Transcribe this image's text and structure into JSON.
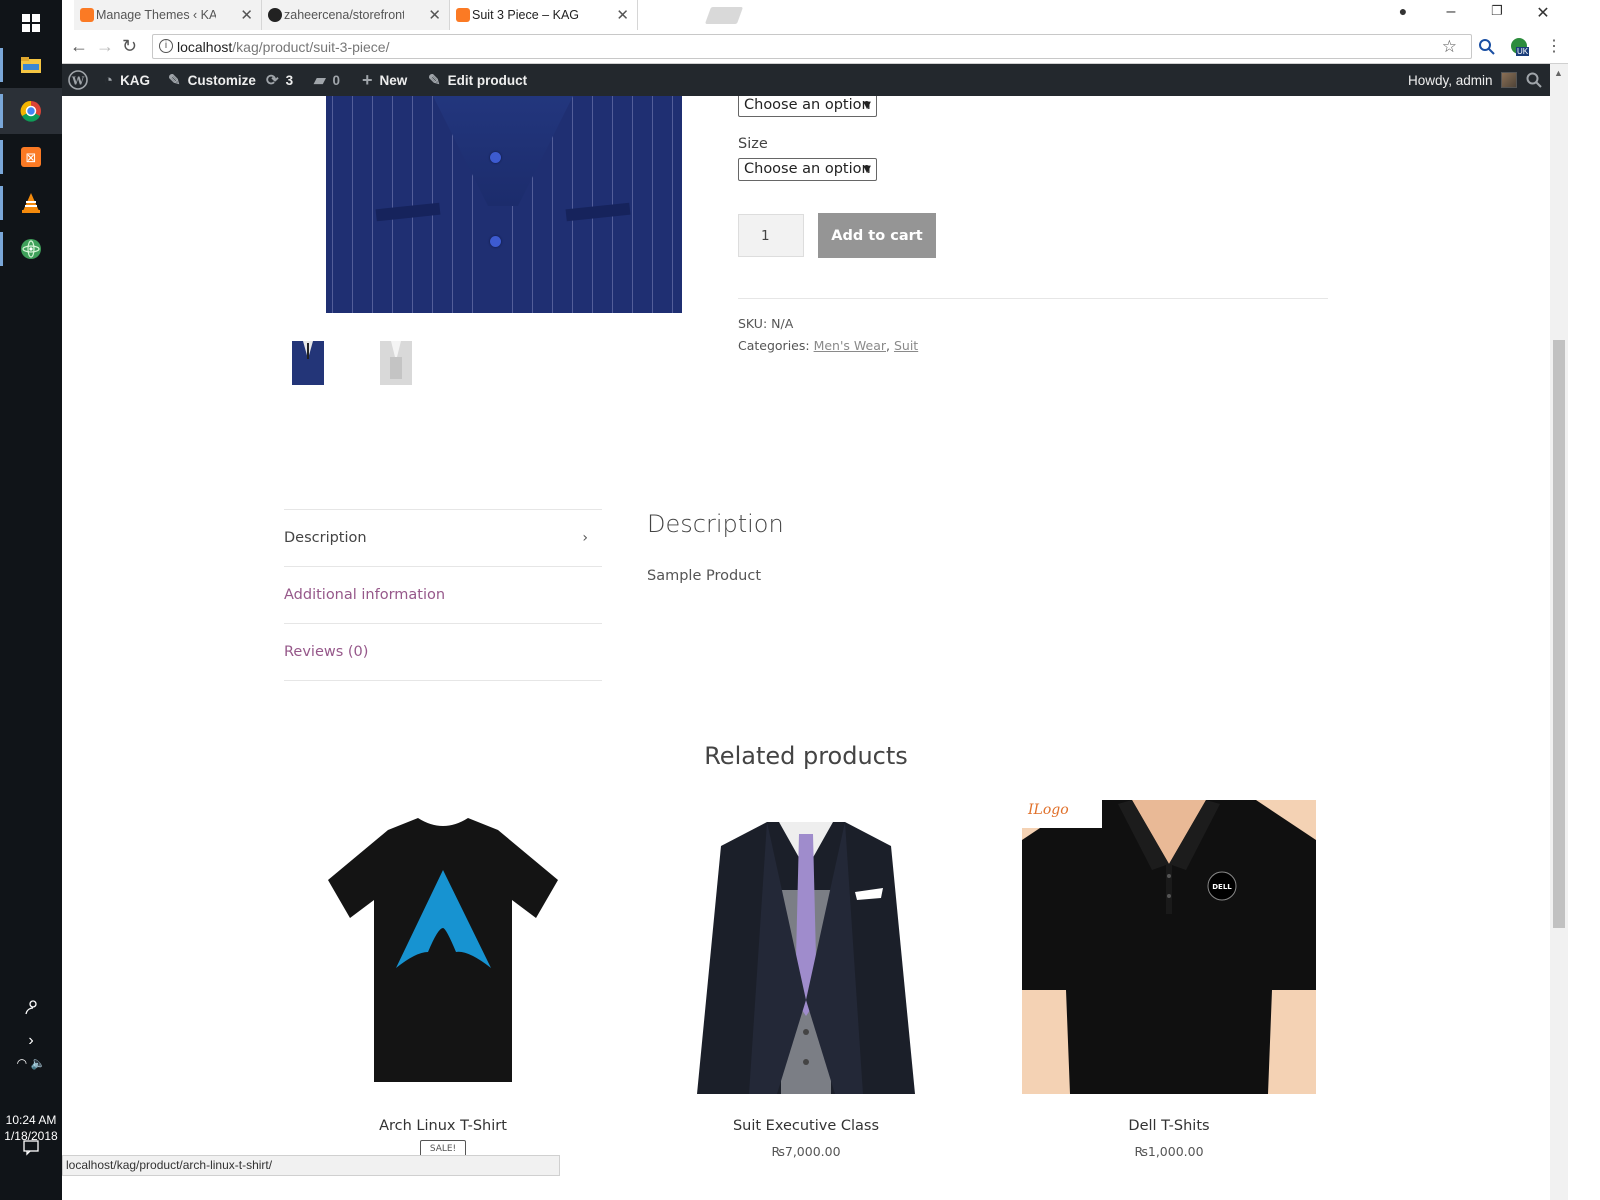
{
  "browser": {
    "tabs": [
      {
        "title": "Manage Themes ‹ KAG —",
        "active": false
      },
      {
        "title": "zaheercena/storefront: C",
        "active": false
      },
      {
        "title": "Suit 3 Piece – KAG",
        "active": true
      }
    ],
    "url_host": "localhost",
    "url_path": "/kag/product/suit-3-piece/",
    "ext_badge": "UK",
    "status_url": "localhost/kag/product/arch-linux-t-shirt/"
  },
  "adminbar": {
    "site_name": "KAG",
    "customize": "Customize",
    "updates_count": "3",
    "comments_count": "0",
    "new_label": "New",
    "edit_label": "Edit product",
    "howdy": "Howdy, admin"
  },
  "product": {
    "option_placeholder_1": "Choose an option",
    "size_label": "Size",
    "option_placeholder_2": "Choose an option",
    "quantity": "1",
    "add_to_cart": "Add to cart",
    "sku_label": "SKU:",
    "sku_value": "N/A",
    "categories_label": "Categories:",
    "categories": [
      "Men's Wear",
      "Suit"
    ]
  },
  "tabs": {
    "items": [
      "Description",
      "Additional information",
      "Reviews (0)"
    ],
    "panel_title": "Description",
    "panel_text": "Sample Product"
  },
  "related": {
    "heading": "Related products",
    "products": [
      {
        "name": "Arch Linux T-Shirt",
        "badge": "SALE!"
      },
      {
        "name": "Suit Executive Class",
        "price": "₨7,000.00"
      },
      {
        "name": "Dell T-Shits",
        "price": "₨1,000.00",
        "image_logo": "ILogo",
        "image_brand": "DELL"
      }
    ]
  },
  "taskbar": {
    "time": "10:24 AM",
    "date": "1/18/2018"
  },
  "colors": {
    "admin_bar": "#23282d",
    "tab_link": "#96588a",
    "add_to_cart_bg": "#959595"
  }
}
